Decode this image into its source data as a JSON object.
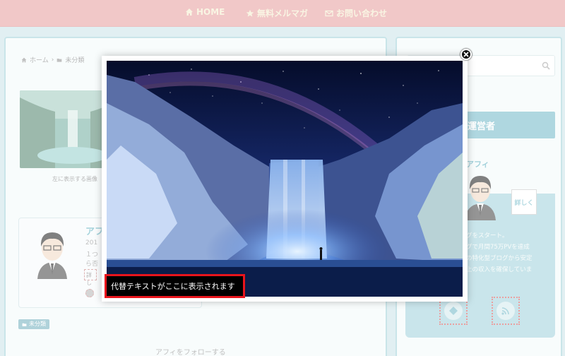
{
  "nav": {
    "home": "HOME",
    "newsletter": "無料メルマガ",
    "contact": "お問い合わせ"
  },
  "breadcrumb": {
    "home": "ホーム",
    "category": "未分類"
  },
  "post": {
    "thumb_caption": "左に表示する画像",
    "category_tag": "未分類",
    "follow_text": "アフィをフォローする"
  },
  "author": {
    "name": "アフ",
    "year": "201",
    "line1": "１つ",
    "line2": "ら否",
    "detail_label": "詳し"
  },
  "sidebar": {
    "header": "運営者",
    "name": "アフィ",
    "detail_label": "詳しく",
    "text_lines": [
      "グをスタート。",
      "グで月間75万PVを達成",
      "の特化型ブログから安定",
      "上の収入を確保していま"
    ],
    "icons": [
      "feedly-icon",
      "rss-icon"
    ]
  },
  "lightbox": {
    "caption": "代替テキストがここに表示されます"
  },
  "colors": {
    "nav_bg": "#e8a6a6",
    "nav_text": "#f6efd2",
    "accent": "#7fbfcd",
    "caption_border": "#e8141c"
  }
}
